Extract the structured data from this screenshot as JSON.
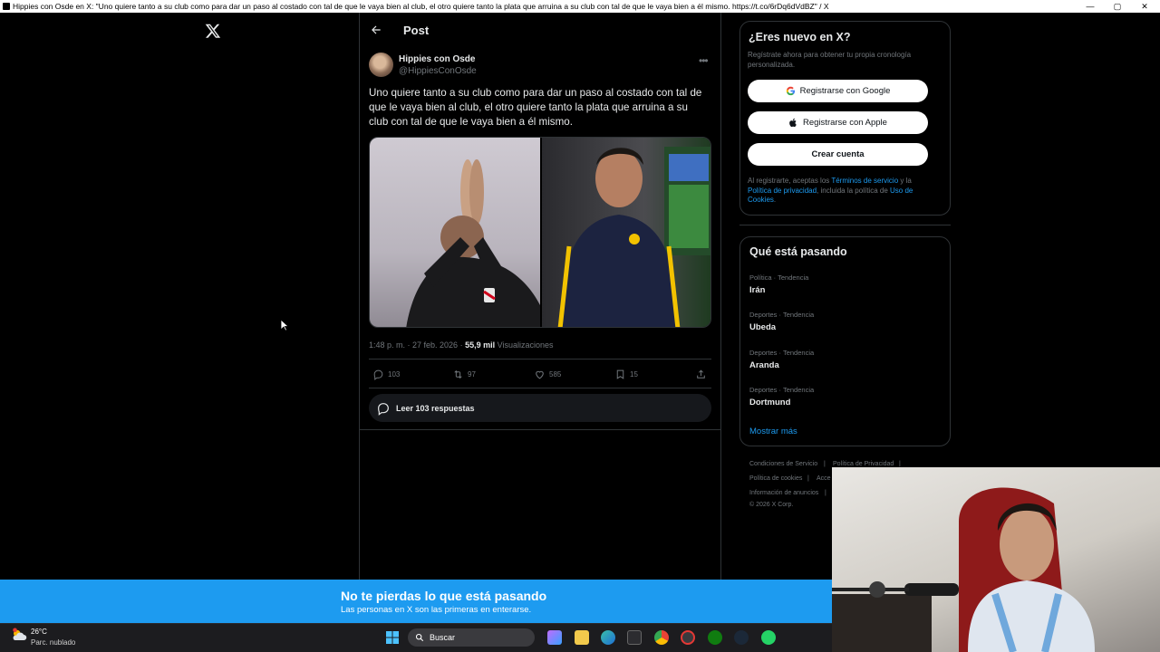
{
  "window": {
    "title": "Hippies con Osde en X: \"Uno quiere tanto a su club como para dar un paso al costado con tal de que le vaya bien al club, el otro quiere tanto la plata que arruina a su club con tal de que le vaya bien a él mismo. https://t.co/6rDq6dVdBZ\" / X",
    "minimize": "—",
    "maximize": "▢",
    "close": "✕"
  },
  "header": {
    "title": "Post"
  },
  "post": {
    "author_name": "Hippies con Osde",
    "author_handle": "@HippiesConOsde",
    "text": "Uno quiere tanto a su club como para dar un paso al costado con tal de que le vaya bien al club, el otro quiere tanto la plata que arruina a su club con tal de que le vaya bien a él mismo.",
    "time": "1:48 p. m. · 27 feb. 2026 ·",
    "views_count": "55,9 mil",
    "views_label": "Visualizaciones",
    "replies": "103",
    "reposts": "97",
    "likes": "585",
    "bookmarks": "15",
    "read_replies": "Leer 103 respuestas"
  },
  "signup": {
    "title": "¿Eres nuevo en X?",
    "subtitle": "Regístrate ahora para obtener tu propia cronología personalizada.",
    "google": "Registrarse con Google",
    "apple": "Registrarse con Apple",
    "create": "Crear cuenta",
    "terms_prefix": "Al registrarte, aceptas los",
    "terms_link": "Términos de servicio",
    "terms_and": "y la",
    "privacy_link": "Política de privacidad",
    "terms_mid": ", incluida la política de",
    "cookies_link": "Uso de Cookies",
    "terms_end": "."
  },
  "trends": {
    "title": "Qué está pasando",
    "items": [
      {
        "category": "Política · Tendencia",
        "name": "Irán"
      },
      {
        "category": "Deportes · Tendencia",
        "name": "Ubeda"
      },
      {
        "category": "Deportes · Tendencia",
        "name": "Aranda"
      },
      {
        "category": "Deportes · Tendencia",
        "name": "Dortmund"
      }
    ],
    "show_more": "Mostrar más"
  },
  "footer": {
    "tos": "Condiciones de Servicio",
    "privacy": "Política de Privacidad",
    "cookies": "Política de cookies",
    "accessibility": "Acce",
    "ads": "Información de anuncios",
    "copyright": "© 2026 X Corp.",
    "sep": "|"
  },
  "banner": {
    "title": "No te pierdas lo que está pasando",
    "subtitle": "Las personas en X son las primeras en enterarse."
  },
  "taskbar": {
    "temperature": "26°C",
    "condition": "Parc. nublado",
    "search": "Buscar"
  },
  "colors": {
    "accent": "#1d9bf0",
    "background": "#000000",
    "border": "#2f3336"
  }
}
